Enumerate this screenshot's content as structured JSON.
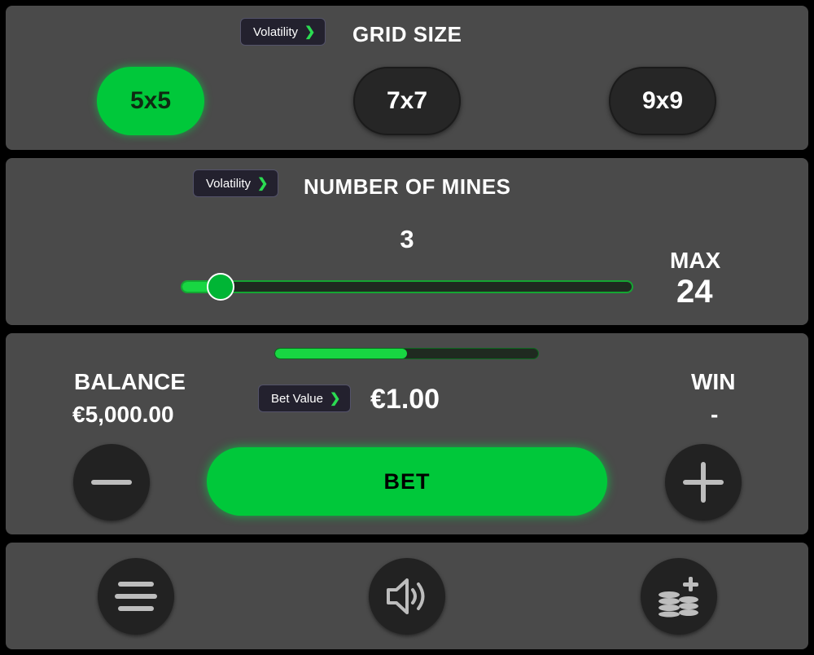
{
  "grid": {
    "volatility_label": "Volatility",
    "title": "GRID SIZE",
    "options": [
      "5x5",
      "7x7",
      "9x9"
    ],
    "selected": "5x5"
  },
  "mines": {
    "volatility_label": "Volatility",
    "title": "NUMBER OF MINES",
    "count": "3",
    "slider_fraction": 0.07,
    "max_label": "MAX",
    "max_value": "24"
  },
  "bet": {
    "progress_fraction": 0.5,
    "balance_label": "BALANCE",
    "balance_value": "€5,000.00",
    "bet_value_label": "Bet Value",
    "bet_value": "€1.00",
    "win_label": "WIN",
    "win_value": "-",
    "bet_button": "BET"
  },
  "colors": {
    "accent": "#00c83a",
    "panel": "#4a4a4a"
  },
  "icons": {
    "decrease": "minus-icon",
    "increase": "plus-icon",
    "menu": "menu-icon",
    "sound": "speaker-icon",
    "coins": "coins-plus-icon"
  }
}
